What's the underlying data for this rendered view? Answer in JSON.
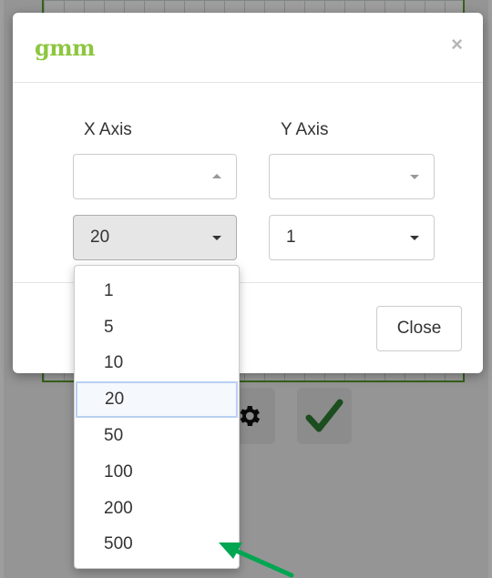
{
  "modal": {
    "brand": "gmm",
    "close_icon": "×",
    "x_axis_label": "X Axis",
    "y_axis_label": "Y Axis",
    "x_scale_selected": "20",
    "y_scale_selected": "1",
    "close_button_label": "Close"
  },
  "dropdown": {
    "options": [
      "1",
      "5",
      "10",
      "20",
      "50",
      "100",
      "200",
      "500"
    ],
    "selected": "20"
  },
  "background": {
    "tools": [
      "gear-icon",
      "checkmark-icon"
    ]
  },
  "colors": {
    "brand": "#8dc63f",
    "grid_border": "#5aa02c",
    "check": "#2e7d32",
    "arrow": "#00a651",
    "highlight_border": "#b9d0f2"
  }
}
